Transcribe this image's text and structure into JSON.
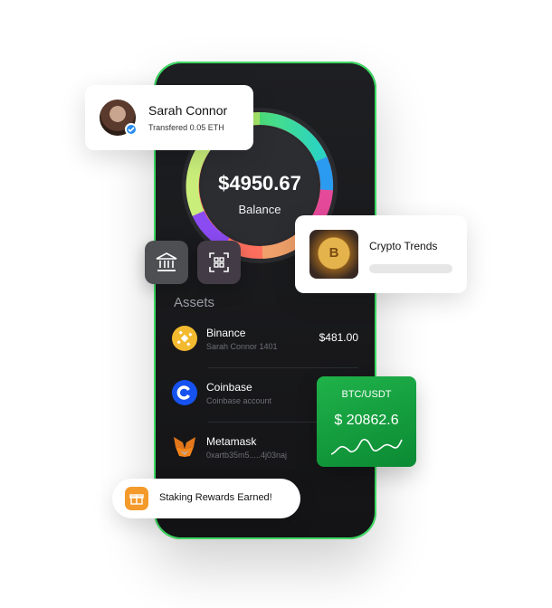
{
  "balance": {
    "amount": "$4950.67",
    "label": "Balance"
  },
  "user_card": {
    "name": "Sarah Connor",
    "subtitle": "Transfered 0.05 ETH"
  },
  "trend_card": {
    "title": "Crypto Trends"
  },
  "assets": {
    "title": "Assets",
    "items": [
      {
        "name": "Binance",
        "sub": "Sarah Connor 1401",
        "value": "$481.00",
        "icon": "binance-icon",
        "color": "#f3ba2f"
      },
      {
        "name": "Coinbase",
        "sub": "Coinbase account",
        "value": "",
        "icon": "coinbase-icon",
        "color": "#1652f0"
      },
      {
        "name": "Metamask",
        "sub": "0xartb35m5.....4j03naj",
        "value": "",
        "icon": "metamask-icon",
        "color": "#e2761b"
      }
    ]
  },
  "btc_card": {
    "pair": "BTC/USDT",
    "price": "$ 20862.6"
  },
  "toast": {
    "text": "Staking Rewards Earned!"
  },
  "actions": [
    {
      "icon": "bank-icon"
    },
    {
      "icon": "scan-icon"
    }
  ],
  "colors": {
    "phone_border": "#3ddc63",
    "btc_card": "#129f3d",
    "gift": "#f39a2b"
  }
}
